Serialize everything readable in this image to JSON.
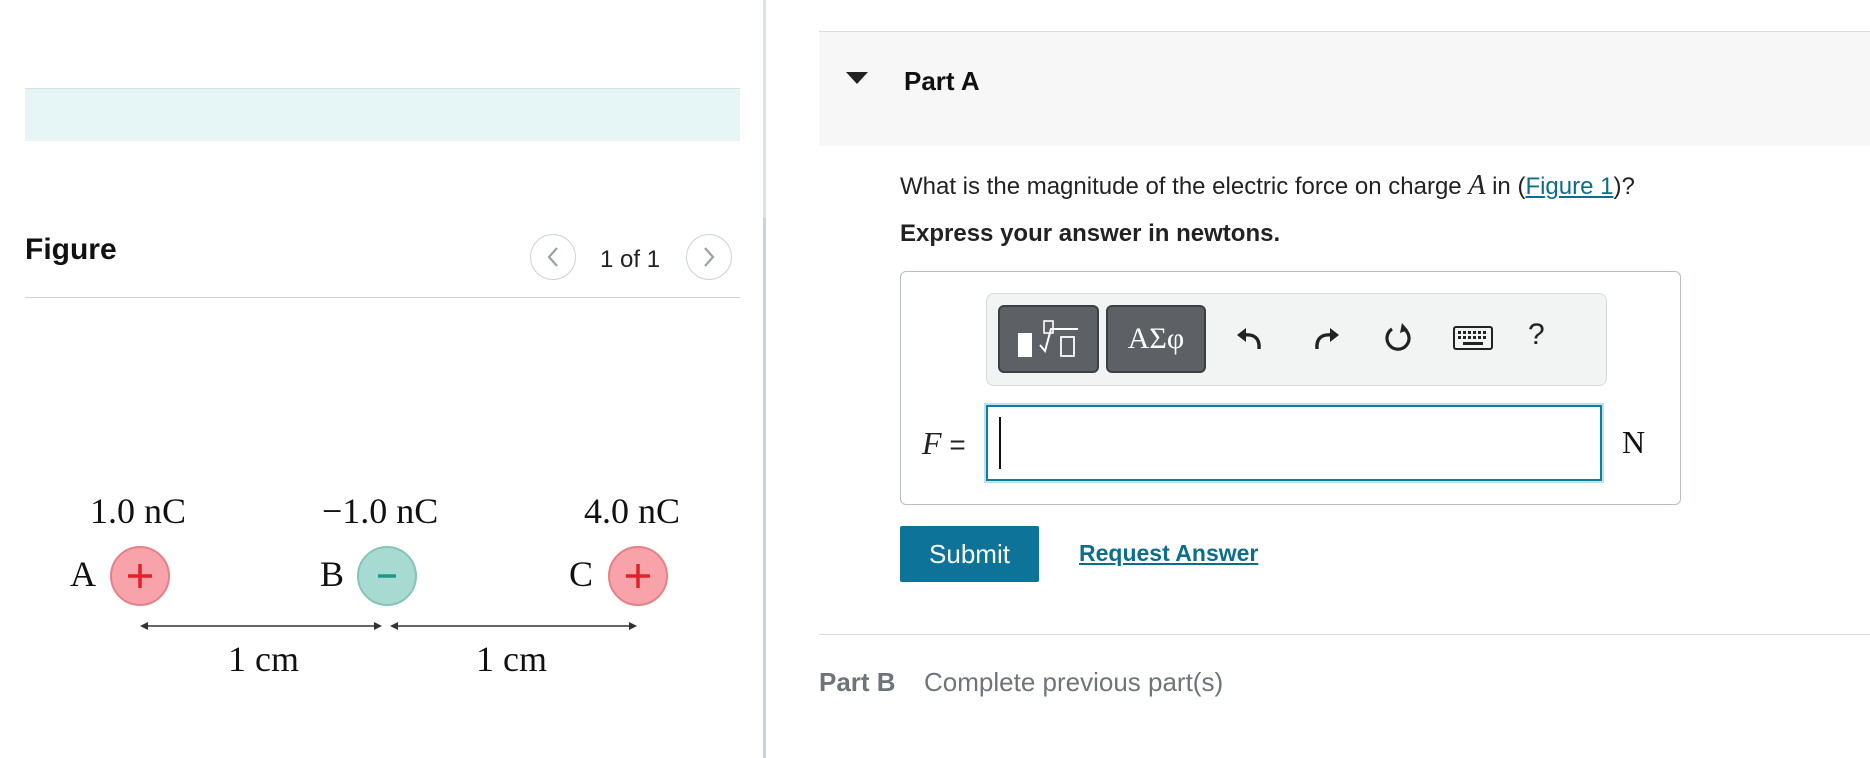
{
  "figure_panel": {
    "title": "Figure",
    "pager": {
      "text": "1 of 1",
      "prev_icon": "chevron-left-icon",
      "next_icon": "chevron-right-icon"
    },
    "charges": [
      {
        "letter": "A",
        "value": "1.0 nC",
        "sign": "+",
        "color": "#f7a3a9"
      },
      {
        "letter": "B",
        "value": "−1.0 nC",
        "sign": "−",
        "color": "#a7dbd2"
      },
      {
        "letter": "C",
        "value": "4.0 nC",
        "sign": "+",
        "color": "#f7a3a9"
      }
    ],
    "distances": [
      "1 cm",
      "1 cm"
    ]
  },
  "part_a": {
    "title": "Part A",
    "question_prefix": "What is the magnitude of the electric force on charge ",
    "question_var": "A",
    "question_mid": " in (",
    "figure_link": "Figure 1",
    "question_suffix": ")?",
    "instruction": "Express your answer in newtons.",
    "toolbar": {
      "templates_icon": "math-templates-icon",
      "symbols_label": "ΑΣφ",
      "undo_icon": "undo-icon",
      "redo_icon": "redo-icon",
      "reset_icon": "reset-icon",
      "keyboard_icon": "keyboard-icon",
      "help_label": "?"
    },
    "variable": "F",
    "equals": "=",
    "answer_value": "",
    "unit": "N",
    "submit_label": "Submit",
    "request_answer_label": "Request Answer"
  },
  "part_b": {
    "title": "Part B",
    "status": "Complete previous part(s)"
  },
  "colors": {
    "accent": "#0d7398",
    "link": "#0d6e8c",
    "teal_bar": "#e6f5f5",
    "positive_charge": "#f7a3a9",
    "negative_charge": "#a7dbd2"
  }
}
